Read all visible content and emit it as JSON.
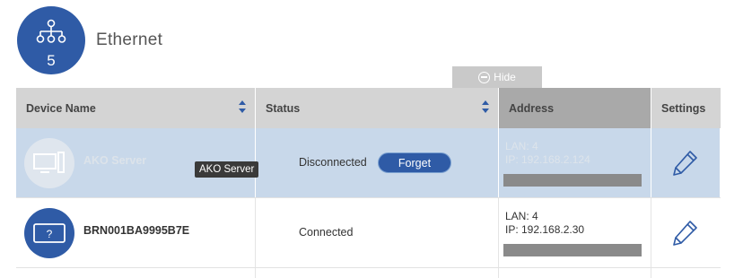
{
  "header": {
    "title": "Ethernet",
    "count": "5",
    "icon": "network-icon",
    "accent": "#2f5ba6"
  },
  "hide_tab": {
    "label": "Hide"
  },
  "table": {
    "columns": [
      "Device Name",
      "Status",
      "Address",
      "Settings"
    ],
    "rows": [
      {
        "name": "AKO Server",
        "tooltip": "AKO Server",
        "icon": "desktop-computer-icon",
        "status": "Disconnected",
        "action": "Forget",
        "lan": "LAN: 4",
        "ip": "IP: 192.168.2.124",
        "selected": true
      },
      {
        "name": "BRN001BA9995B7E",
        "icon": "unknown-device-icon",
        "icon_glyph": "?",
        "status": "Connected",
        "lan": "LAN: 4",
        "ip": "IP: 192.168.2.30",
        "selected": false
      }
    ]
  }
}
